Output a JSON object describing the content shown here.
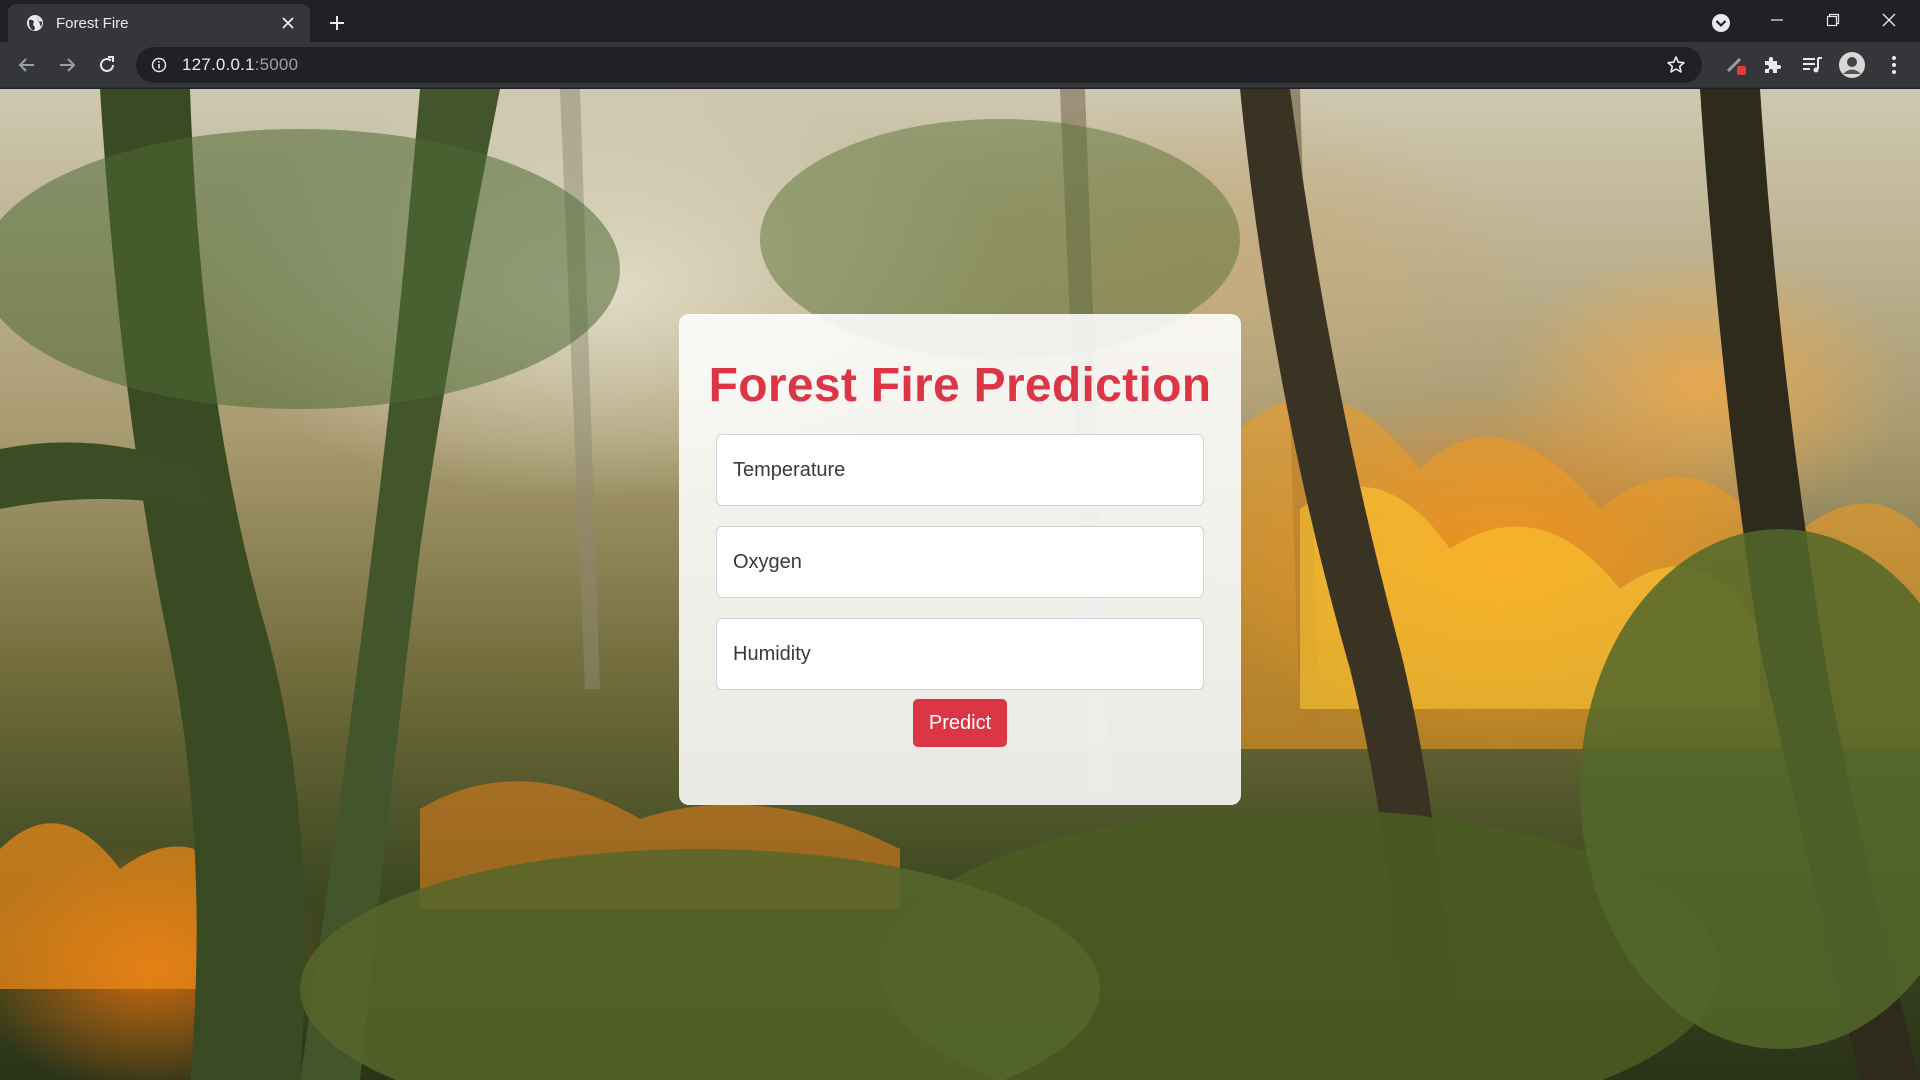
{
  "browser": {
    "tab_title": "Forest Fire",
    "url_host": "127.0.0.1",
    "url_port": ":5000"
  },
  "page": {
    "title": "Forest Fire Prediction",
    "fields": [
      {
        "placeholder": "Temperature"
      },
      {
        "placeholder": "Oxygen"
      },
      {
        "placeholder": "Humidity"
      }
    ],
    "predict_label": "Predict",
    "accent_color": "#dc3545"
  }
}
